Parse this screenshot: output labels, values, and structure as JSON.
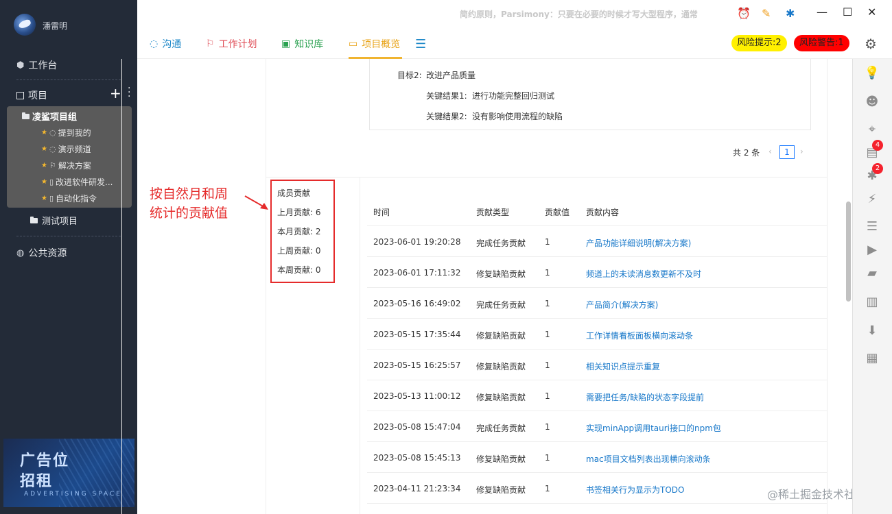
{
  "user": {
    "name": "潘雷明"
  },
  "sidebar": {
    "workbench": "工作台",
    "projects": "项目",
    "group_name": "凌鲨项目组",
    "group_items": [
      {
        "label": "提到我的",
        "icon": "chat-icon"
      },
      {
        "label": "演示频道",
        "icon": "chat-icon"
      },
      {
        "label": "解决方案",
        "icon": "flag-icon"
      },
      {
        "label": "改进软件研发...",
        "icon": "doc-icon"
      },
      {
        "label": "自动化指令",
        "icon": "doc-icon"
      }
    ],
    "test_project": "测试项目",
    "public_resources": "公共资源",
    "ad": {
      "line1": "广告位",
      "line2": "招租",
      "line3": "ADVERTISING SPACE"
    }
  },
  "titlebar": {
    "motto": "简约原则，Parsimony：只要在必要的时候才写大型程序，通常"
  },
  "tabs": [
    {
      "label": "沟通",
      "color": "#1e88c8"
    },
    {
      "label": "工作计划",
      "color": "#e0505a"
    },
    {
      "label": "知识库",
      "color": "#2aa150"
    },
    {
      "label": "项目概览",
      "color": "#e8a317"
    }
  ],
  "risk": {
    "hint": "风险提示:2",
    "warn": "风险警告:1"
  },
  "rightbar_badges": {
    "docs": "4",
    "bugs": "2"
  },
  "goal": {
    "title_label": "目标2:",
    "title": "改进产品质量",
    "kr1_label": "关键结果1:",
    "kr1": "进行功能完整回归测试",
    "kr2_label": "关键结果2:",
    "kr2": "没有影响使用流程的缺陷"
  },
  "pager": {
    "total": "共 2 条",
    "current": "1"
  },
  "member": {
    "title": "成员贡献",
    "last_month": "上月贡献: 6",
    "this_month": "本月贡献: 2",
    "last_week": "上周贡献: 0",
    "this_week": "本周贡献: 0"
  },
  "annotation": {
    "line1": "按自然月和周",
    "line2": "统计的贡献值"
  },
  "table": {
    "headers": [
      "时间",
      "贡献类型",
      "贡献值",
      "贡献内容"
    ],
    "rows": [
      [
        "2023-06-01 19:20:28",
        "完成任务贡献",
        "1",
        "产品功能详细说明(解决方案)"
      ],
      [
        "2023-06-01 17:11:32",
        "修复缺陷贡献",
        "1",
        "频道上的未读消息数更新不及时"
      ],
      [
        "2023-05-16 16:49:02",
        "完成任务贡献",
        "1",
        "产品简介(解决方案)"
      ],
      [
        "2023-05-15 17:35:44",
        "修复缺陷贡献",
        "1",
        "工作详情看板面板横向滚动条"
      ],
      [
        "2023-05-15 16:25:57",
        "修复缺陷贡献",
        "1",
        "相关知识点提示重复"
      ],
      [
        "2023-05-13 11:00:12",
        "修复缺陷贡献",
        "1",
        "需要把任务/缺陷的状态字段提前"
      ],
      [
        "2023-05-08 15:47:04",
        "完成任务贡献",
        "1",
        "实现minApp调用tauri接口的npm包"
      ],
      [
        "2023-05-08 15:45:13",
        "修复缺陷贡献",
        "1",
        "mac项目文档列表出现横向滚动条"
      ],
      [
        "2023-04-11 21:23:34",
        "修复缺陷贡献",
        "1",
        "书签相关行为显示为TODO"
      ]
    ]
  },
  "watermark": "@稀土掘金技术社区"
}
